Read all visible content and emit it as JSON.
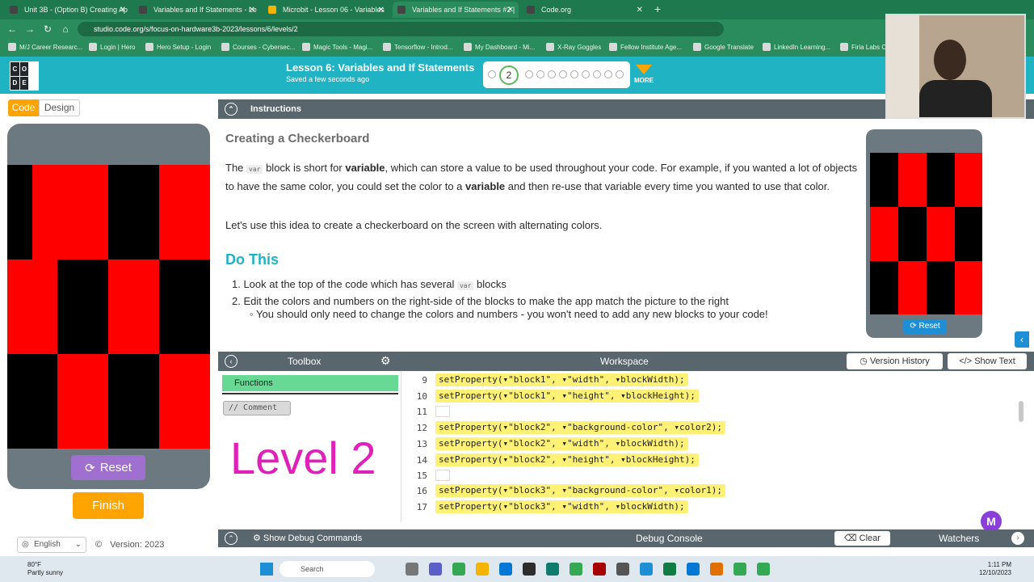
{
  "browser": {
    "tabs": [
      {
        "title": "Unit 3B - (Option B) Creating Ap",
        "color": "#444"
      },
      {
        "title": "Variables and If Statements - Le",
        "color": "#444"
      },
      {
        "title": "Microbit - Lesson 06 - Variables",
        "color": "#f4b400"
      },
      {
        "title": "Variables and If Statements #2 |",
        "color": "#444"
      },
      {
        "title": "Code.org",
        "color": "#444"
      }
    ],
    "url": "studio.code.org/s/focus-on-hardware3b-2023/lessons/6/levels/2",
    "bookmarks": [
      "M/J Career Researc...",
      "Login | Hero",
      "Hero Setup - Login",
      "Courses - Cybersec...",
      "Magic Tools - Magi...",
      "Tensorflow - Introd...",
      "My Dashboard - Mi...",
      "X-Ray Goggles",
      "Fellow Institute Age...",
      "Google Translate",
      "LinkedIn Learning...",
      "Firia Labs Co"
    ]
  },
  "header": {
    "logo_letters": [
      "C",
      "O",
      "",
      "D",
      "E",
      ""
    ],
    "lesson_title": "Lesson 6: Variables and If Statements",
    "saved": "Saved a few seconds ago",
    "current_level": "2",
    "more_label": "MORE"
  },
  "left": {
    "code_tab": "Code",
    "design_tab": "Design",
    "reset_label": "Reset",
    "finish_label": "Finish",
    "language": "English",
    "version": "Version: 2023"
  },
  "instructions": {
    "bar_title": "Instructions",
    "heading": "Creating a Checkerboard",
    "p1_a": "The ",
    "p1_chip": "var",
    "p1_b": " block is short for ",
    "p1_bold1": "variable",
    "p1_c": ", which can store a value to be used throughout your code. For example, if you wanted a lot of objects to have the same color, you could set the color to a ",
    "p1_bold2": "variable",
    "p1_d": " and then re-use that variable every time you wanted to use that color.",
    "p2": "Let's use this idea to create a checkerboard on the screen with alternating colors.",
    "do_this": "Do This",
    "step1_a": "1. Look at the top of the code which has several ",
    "step1_chip": "var",
    "step1_b": " blocks",
    "step2": "2. Edit the colors and numbers on the right-side of the blocks to make the app match the picture to the right",
    "step2_sub": "You should only need to change the colors and numbers - you won't need to add any new blocks to your code!",
    "mini_reset": "Reset"
  },
  "workspace": {
    "toolbox_title": "Toolbox",
    "workspace_title": "Workspace",
    "version_history": "Version History",
    "show_text": "Show Text",
    "category": "Functions",
    "comment_block": "// Comment",
    "level_image_text": "Level 2",
    "lines": [
      {
        "n": "9",
        "code": "setProperty(▾\"block1\", ▾\"width\", ▾blockWidth);"
      },
      {
        "n": "10",
        "code": "setProperty(▾\"block1\", ▾\"height\", ▾blockHeight);"
      },
      {
        "n": "11",
        "code": ""
      },
      {
        "n": "12",
        "code": "setProperty(▾\"block2\", ▾\"background-color\", ▾color2);"
      },
      {
        "n": "13",
        "code": "setProperty(▾\"block2\", ▾\"width\", ▾blockWidth);"
      },
      {
        "n": "14",
        "code": "setProperty(▾\"block2\", ▾\"height\", ▾blockHeight);"
      },
      {
        "n": "15",
        "code": ""
      },
      {
        "n": "16",
        "code": "setProperty(▾\"block3\", ▾\"background-color\", ▾color1);"
      },
      {
        "n": "17",
        "code": "setProperty(▾\"block3\", ▾\"width\", ▾blockWidth);"
      }
    ]
  },
  "debug": {
    "show_debug": "Show Debug Commands",
    "console": "Debug Console",
    "clear": "Clear",
    "watchers": "Watchers"
  },
  "taskbar": {
    "temp": "80°F",
    "weather": "Partly sunny",
    "search": "Search",
    "time": "1:11 PM",
    "date": "12/10/2023"
  },
  "colors": {
    "teal": "#20b3c4",
    "orange": "#ffa400",
    "red": "#ff0000",
    "block_yellow": "#fff176"
  }
}
